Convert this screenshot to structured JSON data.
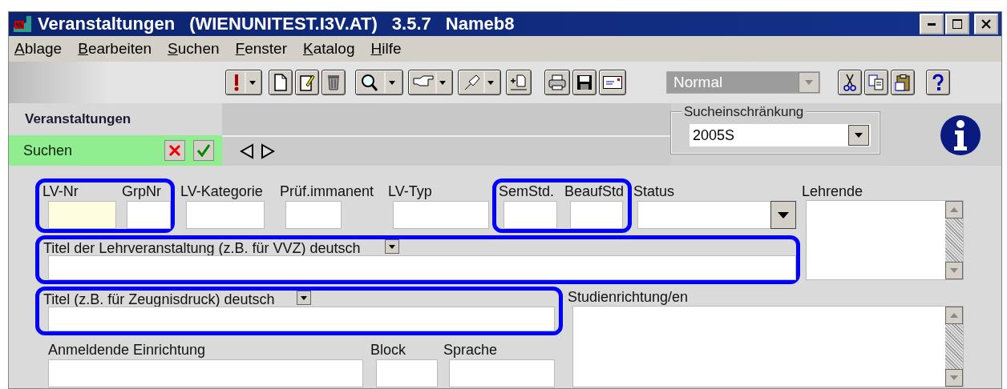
{
  "window": {
    "title_parts": [
      "Veranstaltungen",
      "(WIENUNITEST.I3V.AT)",
      "3.5.7",
      "Nameb8"
    ]
  },
  "menu": [
    "Ablage",
    "Bearbeiten",
    "Suchen",
    "Fenster",
    "Katalog",
    "Hilfe"
  ],
  "toolbar": {
    "style_select": {
      "value": "Normal",
      "disabled": true
    }
  },
  "panel": {
    "title": "Veranstaltungen",
    "mode": "Suchen"
  },
  "restriction": {
    "label": "Sucheinschränkung",
    "value": "2005S"
  },
  "row1": [
    {
      "highlighted": true,
      "fields": [
        {
          "label": "LV-Nr",
          "kind": "text",
          "focused": true
        },
        {
          "label": "GrpNr",
          "kind": "text",
          "focused": false
        }
      ]
    },
    {
      "highlighted": false,
      "fields": [
        {
          "label": "LV-Kategorie",
          "kind": "text",
          "focused": false
        },
        {
          "label": "Prüf.immanent",
          "kind": "text",
          "focused": false
        },
        {
          "label": "LV-Typ",
          "kind": "text",
          "focused": false
        }
      ]
    },
    {
      "highlighted": true,
      "fields": [
        {
          "label": "SemStd.",
          "kind": "text",
          "focused": false
        },
        {
          "label": "BeaufStd",
          "kind": "text",
          "focused": false
        }
      ]
    },
    {
      "highlighted": false,
      "fields": [
        {
          "label": "Status",
          "kind": "select",
          "focused": false
        }
      ]
    }
  ],
  "title_de": {
    "label": "Titel der Lehrveranstaltung (z.B. für VVZ) deutsch",
    "highlighted": true
  },
  "title_cert": {
    "label": "Titel (z.B. für Zeugnisdruck) deutsch",
    "highlighted": true
  },
  "lehrende": {
    "label": "Lehrende"
  },
  "studienrichtung": {
    "label": "Studienrichtung/en"
  },
  "row4": [
    {
      "label": "Anmeldende Einrichtung"
    },
    {
      "label": "Block"
    },
    {
      "label": "Sprache"
    }
  ]
}
